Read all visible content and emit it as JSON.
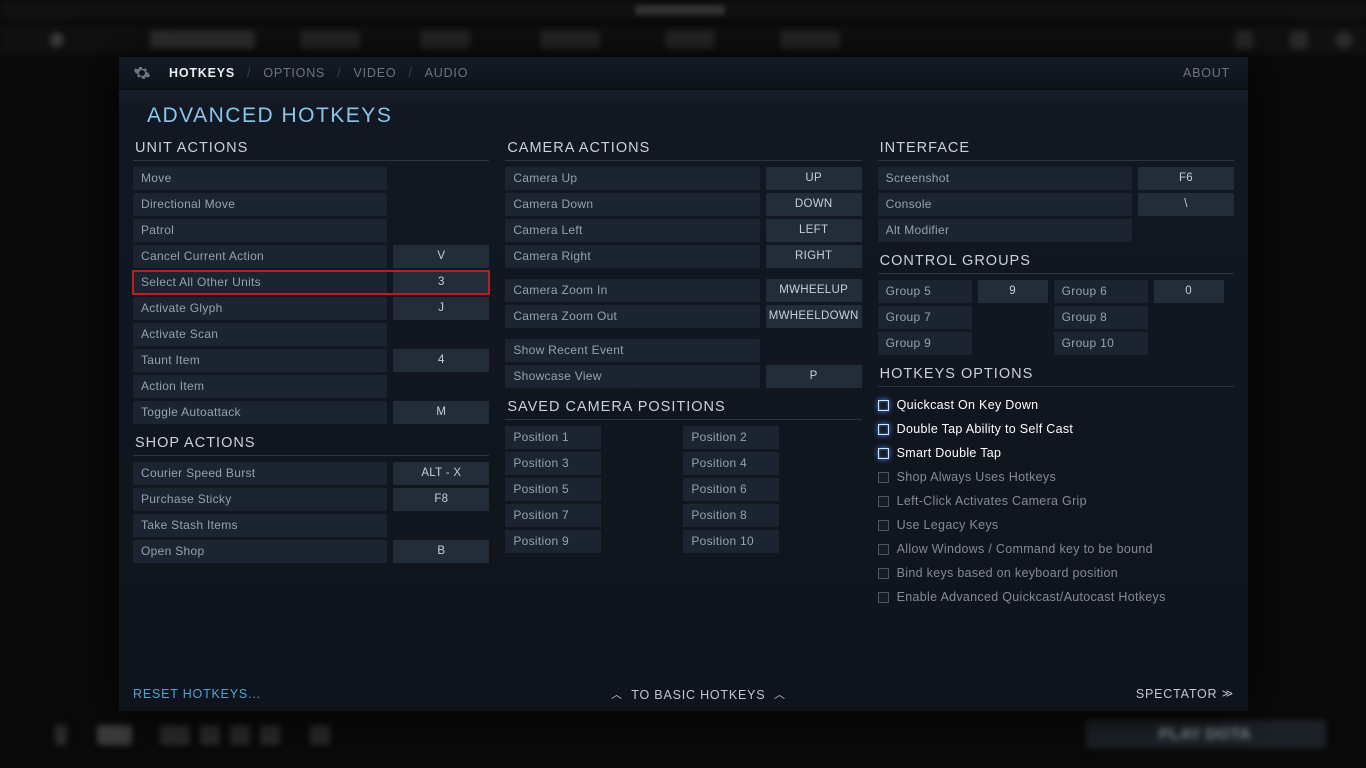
{
  "tabs": {
    "hotkeys": "HOTKEYS",
    "options": "OPTIONS",
    "video": "VIDEO",
    "audio": "AUDIO",
    "about": "ABOUT"
  },
  "title": "ADVANCED HOTKEYS",
  "sections": {
    "unit": "UNIT ACTIONS",
    "shop": "SHOP ACTIONS",
    "camera": "CAMERA ACTIONS",
    "saved": "SAVED CAMERA POSITIONS",
    "interface": "INTERFACE",
    "cg": "CONTROL GROUPS",
    "hkopt": "HOTKEYS OPTIONS"
  },
  "unit": [
    {
      "l": "Move",
      "k": ""
    },
    {
      "l": "Directional Move",
      "k": ""
    },
    {
      "l": "Patrol",
      "k": ""
    },
    {
      "l": "Cancel Current Action",
      "k": "V"
    },
    {
      "l": "Select All Other Units",
      "k": "3",
      "hl": true
    },
    {
      "l": "Activate Glyph",
      "k": "J"
    },
    {
      "l": "Activate Scan",
      "k": ""
    },
    {
      "l": "Taunt Item",
      "k": "4"
    },
    {
      "l": "Action Item",
      "k": ""
    },
    {
      "l": "Toggle Autoattack",
      "k": "M"
    }
  ],
  "shop": [
    {
      "l": "Courier Speed Burst",
      "k": "ALT - X"
    },
    {
      "l": "Purchase Sticky",
      "k": "F8"
    },
    {
      "l": "Take Stash Items",
      "k": ""
    },
    {
      "l": "Open Shop",
      "k": "B"
    }
  ],
  "camera": [
    {
      "l": "Camera Up",
      "k": "UP"
    },
    {
      "l": "Camera Down",
      "k": "DOWN"
    },
    {
      "l": "Camera Left",
      "k": "LEFT"
    },
    {
      "l": "Camera Right",
      "k": "RIGHT"
    }
  ],
  "camera2": [
    {
      "l": "Camera Zoom In",
      "k": "MWHEELUP"
    },
    {
      "l": "Camera Zoom Out",
      "k": "MWHEELDOWN"
    }
  ],
  "camera3": [
    {
      "l": "Show Recent Event",
      "k": ""
    },
    {
      "l": "Showcase View",
      "k": "P"
    }
  ],
  "savedpos": [
    {
      "a": "Position 1",
      "ak": "",
      "b": "Position 2",
      "bk": ""
    },
    {
      "a": "Position 3",
      "ak": "",
      "b": "Position 4",
      "bk": ""
    },
    {
      "a": "Position 5",
      "ak": "",
      "b": "Position 6",
      "bk": ""
    },
    {
      "a": "Position 7",
      "ak": "",
      "b": "Position 8",
      "bk": ""
    },
    {
      "a": "Position 9",
      "ak": "",
      "b": "Position 10",
      "bk": ""
    }
  ],
  "iface": [
    {
      "l": "Screenshot",
      "k": "F6"
    },
    {
      "l": "Console",
      "k": "\\"
    },
    {
      "l": "Alt Modifier",
      "k": ""
    }
  ],
  "cg": [
    {
      "a": "Group 5",
      "ak": "9",
      "b": "Group 6",
      "bk": "0"
    },
    {
      "a": "Group 7",
      "ak": "",
      "b": "Group 8",
      "bk": ""
    },
    {
      "a": "Group 9",
      "ak": "",
      "b": "Group 10",
      "bk": ""
    }
  ],
  "hkopts": [
    {
      "l": "Quickcast On Key Down",
      "glow": true
    },
    {
      "l": "Double Tap Ability to Self Cast",
      "glow": true
    },
    {
      "l": "Smart Double Tap",
      "glow": true
    },
    {
      "l": "Shop Always Uses Hotkeys",
      "glow": false
    },
    {
      "l": "Left-Click Activates Camera Grip",
      "glow": false
    },
    {
      "l": "Use Legacy Keys",
      "glow": false
    },
    {
      "l": "Allow Windows / Command key to be bound",
      "glow": false
    },
    {
      "l": "Bind keys based on keyboard position",
      "glow": false
    },
    {
      "l": "Enable Advanced Quickcast/Autocast Hotkeys",
      "glow": false
    }
  ],
  "footer": {
    "reset": "RESET HOTKEYS...",
    "basic": "TO BASIC HOTKEYS",
    "spectator": "SPECTATOR"
  },
  "bgplay": "PLAY DOTA"
}
